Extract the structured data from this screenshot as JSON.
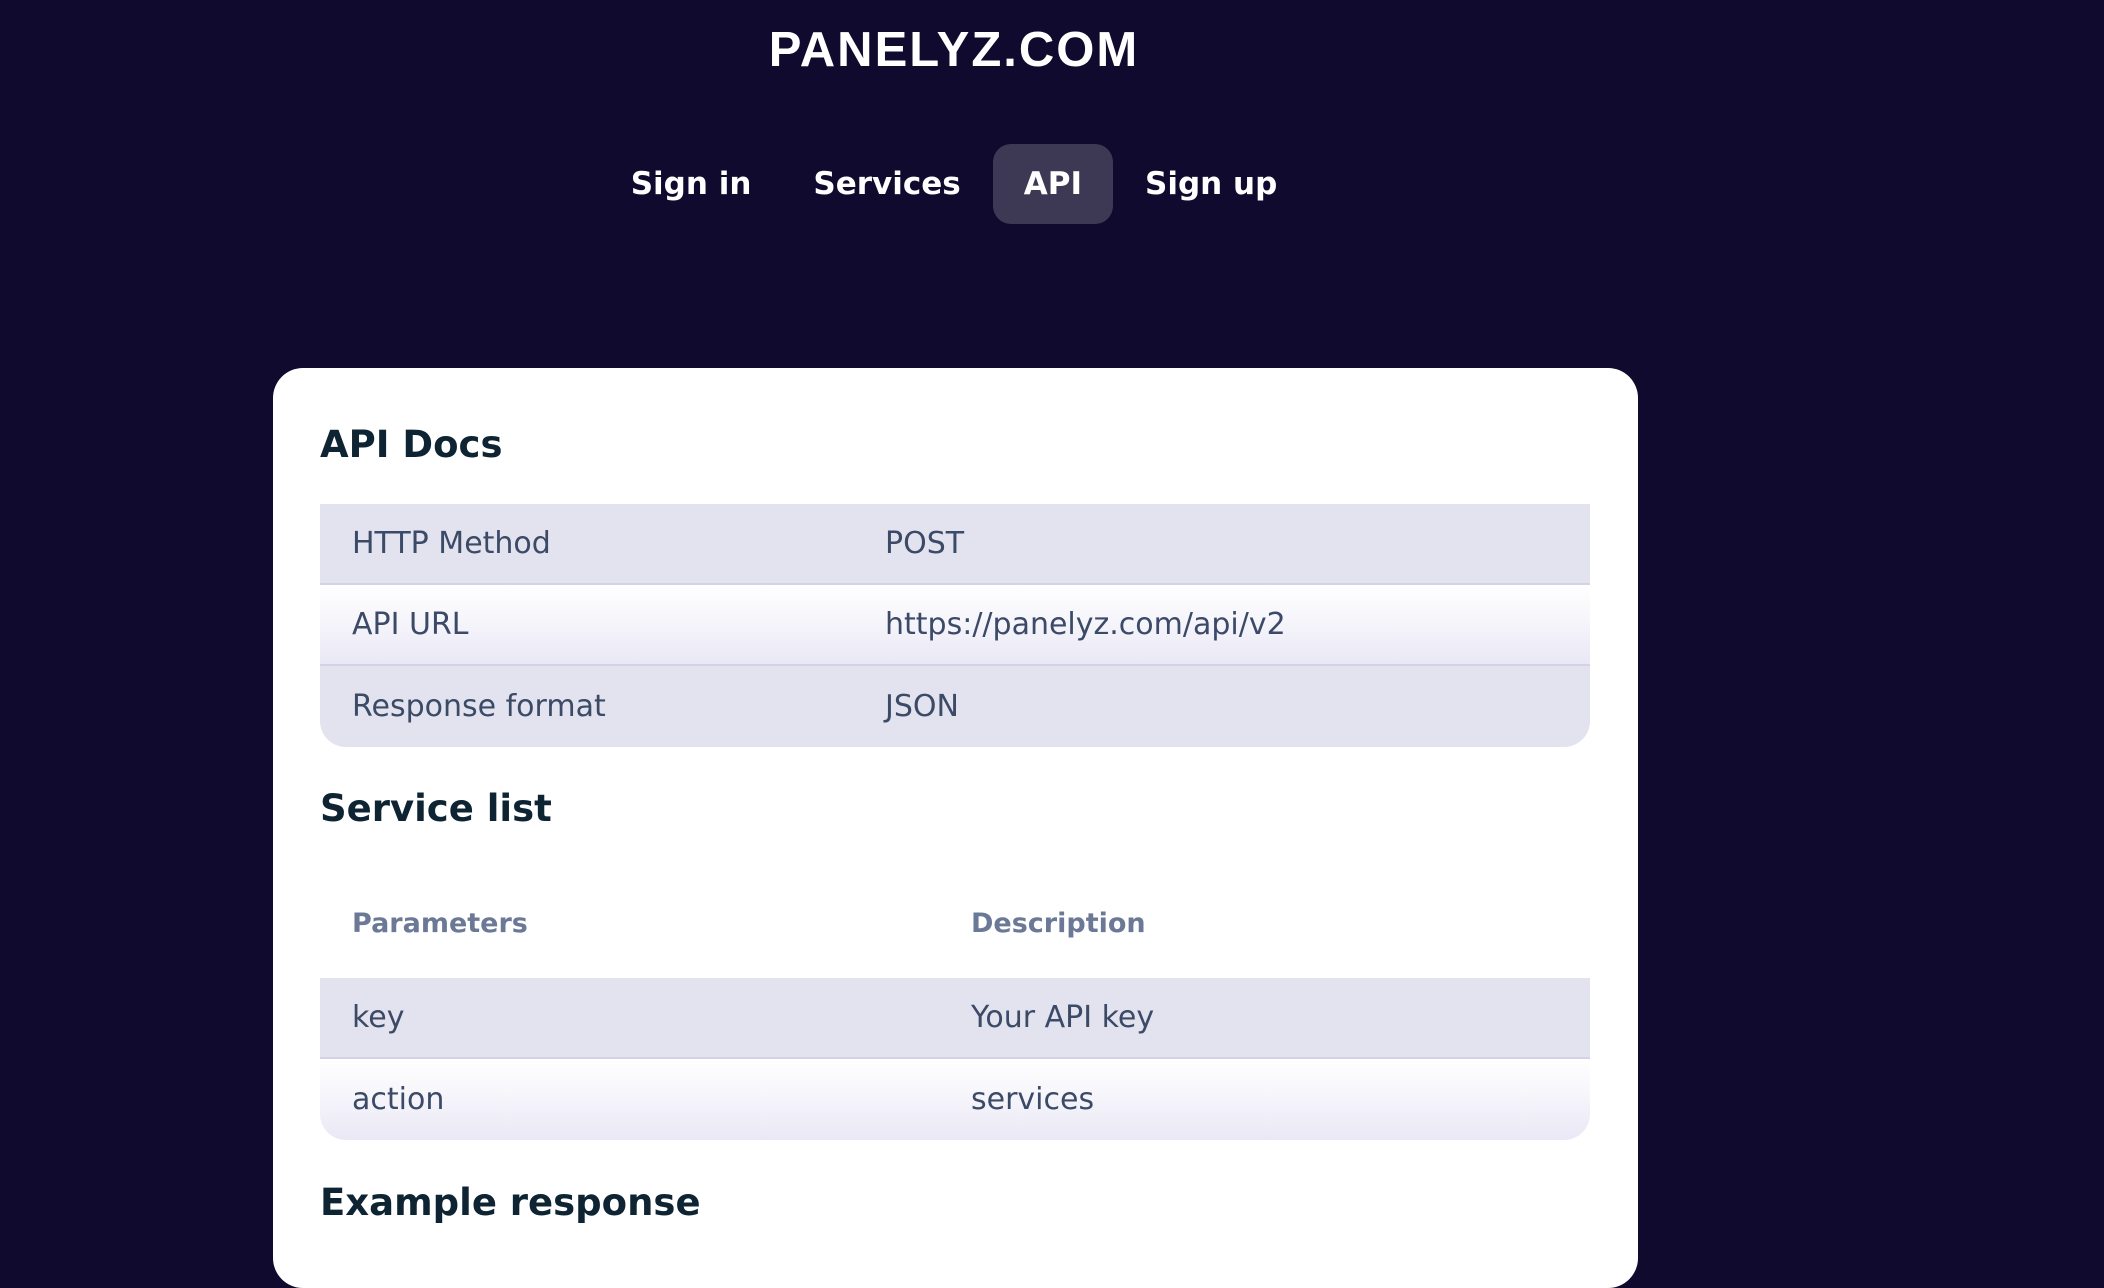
{
  "header": {
    "brand": "PANELYZ.COM"
  },
  "nav": {
    "items": [
      {
        "label": "Sign in"
      },
      {
        "label": "Services"
      },
      {
        "label": "API",
        "active": true
      },
      {
        "label": "Sign up"
      }
    ]
  },
  "api_docs": {
    "title": "API Docs",
    "rows": [
      {
        "label": "HTTP Method",
        "value": "POST"
      },
      {
        "label": "API URL",
        "value": "https://panelyz.com/api/v2"
      },
      {
        "label": "Response format",
        "value": "JSON"
      }
    ]
  },
  "service_list": {
    "title": "Service list",
    "columns": [
      "Parameters",
      "Description"
    ],
    "rows": [
      {
        "param": "key",
        "description": "Your API key"
      },
      {
        "param": "action",
        "description": "services"
      }
    ]
  },
  "example_response": {
    "title": "Example response"
  },
  "colors": {
    "background": "#0f0a2e",
    "nav_active": "#3d3955",
    "card": "#ffffff",
    "row_shaded": "#e3e2ef",
    "heading": "#0e2433",
    "text": "#3b4a66"
  }
}
